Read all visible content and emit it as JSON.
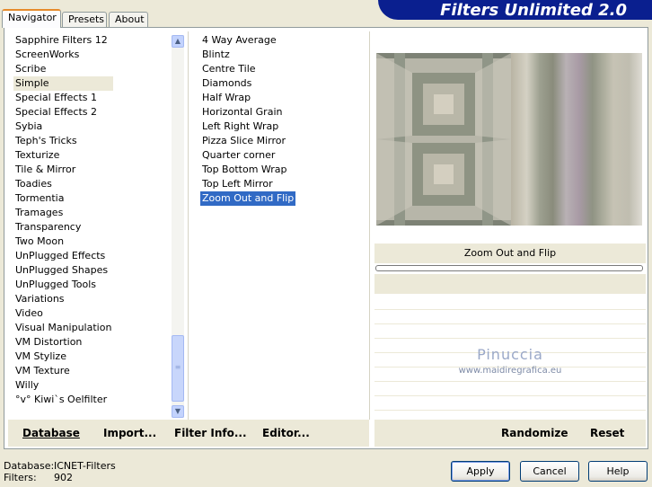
{
  "tabs": [
    "Navigator",
    "Presets",
    "About"
  ],
  "banner": {
    "title": "Filters Unlimited 2.0"
  },
  "categories": [
    "Sapphire Filters 12",
    "ScreenWorks",
    "Scribe",
    "Simple",
    "Special Effects 1",
    "Special Effects 2",
    "Sybia",
    "Teph's Tricks",
    "Texturize",
    "Tile & Mirror",
    "Toadies",
    "Tormentia",
    "Tramages",
    "Transparency",
    "Two Moon",
    "UnPlugged Effects",
    "UnPlugged Shapes",
    "UnPlugged Tools",
    "Variations",
    "Video",
    "Visual Manipulation",
    "VM Distortion",
    "VM Stylize",
    "VM Texture",
    "Willy",
    "°v° Kiwi`s Oelfilter"
  ],
  "selected_category": "Simple",
  "filters": [
    "4 Way Average",
    "Blintz",
    "Centre Tile",
    "Diamonds",
    "Half Wrap",
    "Horizontal Grain",
    "Left Right Wrap",
    "Pizza Slice Mirror",
    "Quarter corner",
    "Top Bottom Wrap",
    "Top Left Mirror",
    "Zoom Out and Flip"
  ],
  "selected_filter": "Zoom Out and Flip",
  "preview": {
    "caption": "Zoom Out and Flip",
    "watermark": "Pinuccia",
    "watermark_url": "www.maidiregrafica.eu",
    "progress": 0
  },
  "toolbar": {
    "database": "Database",
    "import": "Import...",
    "filter_info": "Filter Info...",
    "editor": "Editor...",
    "randomize": "Randomize",
    "reset": "Reset"
  },
  "status": {
    "database_label": "Database:",
    "database_value": "ICNET-Filters",
    "filters_label": "Filters:",
    "filters_value": "902"
  },
  "buttons": {
    "apply": "Apply",
    "cancel": "Cancel",
    "help": "Help"
  },
  "colors": {
    "banner": "#0a1f8f",
    "selection": "#316ac5",
    "dialog": "#ece9d8"
  }
}
